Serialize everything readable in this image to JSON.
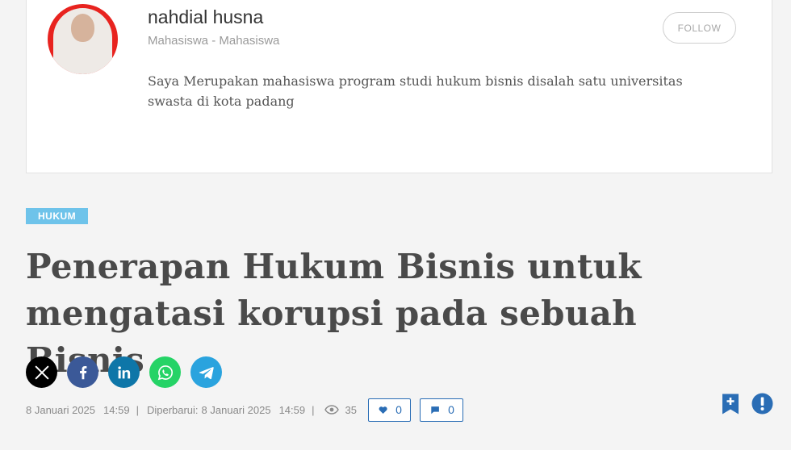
{
  "author": {
    "name": "nahdial husna",
    "role": "Mahasiswa - Mahasiswa",
    "bio": "Saya Merupakan mahasiswa program studi hukum bisnis disalah satu universitas swasta di kota padang",
    "follow_label": "FOLLOW",
    "avatar_icon": "avatar-photo"
  },
  "article": {
    "category": "HUKUM",
    "title": "Penerapan Hukum Bisnis untuk mengatasi korupsi pada sebuah Bisnis"
  },
  "share": [
    {
      "icon": "x-icon",
      "color": "#000000"
    },
    {
      "icon": "facebook-icon",
      "color": "#3b5998"
    },
    {
      "icon": "linkedin-icon",
      "color": "#0e76a8"
    },
    {
      "icon": "whatsapp-icon",
      "color": "#25d366"
    },
    {
      "icon": "telegram-icon",
      "color": "#2aa3de"
    }
  ],
  "meta": {
    "date": "8 Januari 2025",
    "time": "14:59",
    "separator": "|",
    "updated_label": "Diperbarui:",
    "updated_date": "8 Januari 2025",
    "updated_time": "14:59",
    "views": "35",
    "likes": "0",
    "comments": "0"
  },
  "colors": {
    "accent_blue": "#2a6db5",
    "category_badge": "#6ec3ea",
    "background": "#f4f4f4"
  }
}
